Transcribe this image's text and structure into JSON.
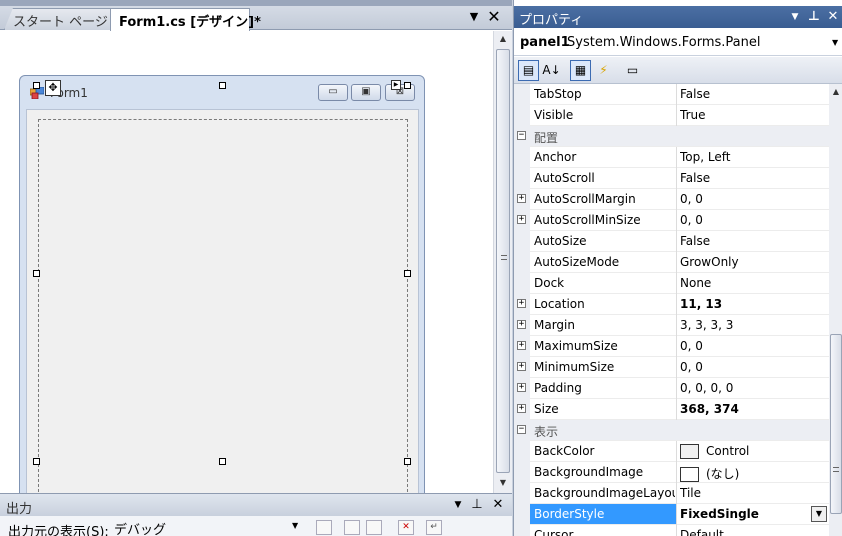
{
  "designer": {
    "tabs": [
      {
        "label": "スタート ページ",
        "active": false
      },
      {
        "label": "Form1.cs [デザイン]*",
        "active": true
      }
    ],
    "form": {
      "title": "Form1",
      "icon": "form-icon",
      "min_glyph": "▭",
      "max_glyph": "▣",
      "close_glyph": "⊠"
    },
    "move_glyph": "✥",
    "smart_tag_glyph": "▶",
    "dropdown_glyph": "▼",
    "close_glyph": "✕"
  },
  "output": {
    "title": "出力",
    "source_label": "出力元の表示(S):",
    "source_value": "デバッグ",
    "pin_glyph": "⊥",
    "dropdown_glyph": "▼",
    "close_glyph": "✕"
  },
  "properties": {
    "title": "プロパティ",
    "object_name": "panel1",
    "object_type": "System.Windows.Forms.Panel",
    "pin_glyph": "⊥",
    "dropdown_glyph": "▼",
    "close_glyph": "✕",
    "toolbar": [
      {
        "name": "categorized-icon",
        "glyph": "▤",
        "active": true
      },
      {
        "name": "alphabetical-icon",
        "glyph": "A↓",
        "active": false
      },
      {
        "name": "properties-icon",
        "glyph": "▦",
        "active": true
      },
      {
        "name": "events-icon",
        "glyph": "⚡",
        "active": false
      },
      {
        "name": "property-pages-icon",
        "glyph": "▭",
        "active": false
      }
    ],
    "rows": [
      {
        "type": "prop",
        "name": "TabStop",
        "value": "False"
      },
      {
        "type": "prop",
        "name": "Visible",
        "value": "True"
      },
      {
        "type": "category",
        "name": "配置",
        "expander": "−"
      },
      {
        "type": "prop",
        "name": "Anchor",
        "value": "Top, Left"
      },
      {
        "type": "prop",
        "name": "AutoScroll",
        "value": "False"
      },
      {
        "type": "prop",
        "name": "AutoScrollMargin",
        "value": "0, 0",
        "expander": "+"
      },
      {
        "type": "prop",
        "name": "AutoScrollMinSize",
        "value": "0, 0",
        "expander": "+"
      },
      {
        "type": "prop",
        "name": "AutoSize",
        "value": "False"
      },
      {
        "type": "prop",
        "name": "AutoSizeMode",
        "value": "GrowOnly"
      },
      {
        "type": "prop",
        "name": "Dock",
        "value": "None"
      },
      {
        "type": "prop",
        "name": "Location",
        "value": "11, 13",
        "expander": "+",
        "bold": true
      },
      {
        "type": "prop",
        "name": "Margin",
        "value": "3, 3, 3, 3",
        "expander": "+"
      },
      {
        "type": "prop",
        "name": "MaximumSize",
        "value": "0, 0",
        "expander": "+"
      },
      {
        "type": "prop",
        "name": "MinimumSize",
        "value": "0, 0",
        "expander": "+"
      },
      {
        "type": "prop",
        "name": "Padding",
        "value": "0, 0, 0, 0",
        "expander": "+"
      },
      {
        "type": "prop",
        "name": "Size",
        "value": "368, 374",
        "expander": "+",
        "bold": true
      },
      {
        "type": "category",
        "name": "表示",
        "expander": "−"
      },
      {
        "type": "prop",
        "name": "BackColor",
        "value": "Control",
        "swatch": "#f0f0f0"
      },
      {
        "type": "prop",
        "name": "BackgroundImage",
        "value": "(なし)",
        "swatch": "#ffffff"
      },
      {
        "type": "prop",
        "name": "BackgroundImageLayout",
        "value": "Tile"
      },
      {
        "type": "prop",
        "name": "BorderStyle",
        "value": "FixedSingle",
        "selected": true,
        "bold": true,
        "dropdown": true
      },
      {
        "type": "prop",
        "name": "Cursor",
        "value": "Default"
      }
    ]
  },
  "colors": {
    "header_active": "#3a5d92",
    "selection": "#3399ff",
    "category_bg": "#eceef3"
  }
}
